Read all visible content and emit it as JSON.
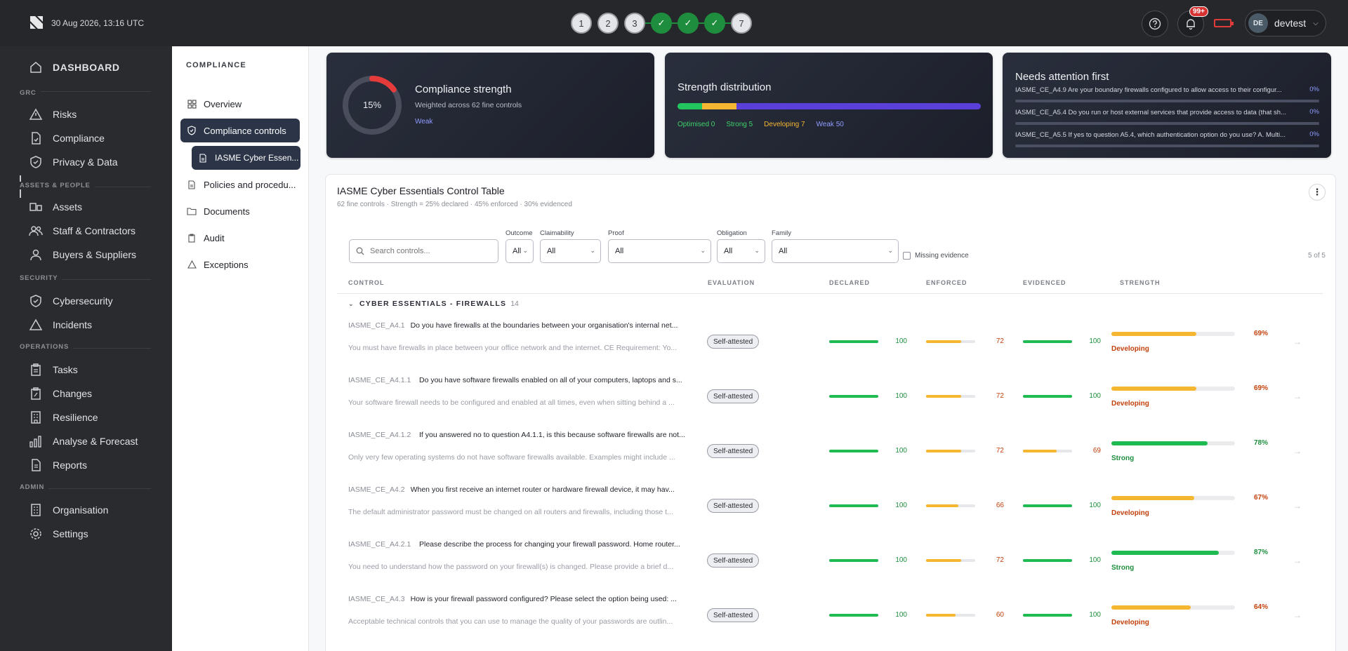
{
  "topbar": {
    "timestamp": "30 Aug 2026, 13:16 UTC",
    "steps": [
      {
        "label": "1",
        "done": false
      },
      {
        "label": "2",
        "done": false
      },
      {
        "label": "3",
        "done": false
      },
      {
        "label": "✓",
        "done": true
      },
      {
        "label": "✓",
        "done": true
      },
      {
        "label": "✓",
        "done": true
      },
      {
        "label": "7",
        "done": false
      }
    ],
    "notification_badge": "99+",
    "user_initials": "DE",
    "username": "devtest",
    "icons": {
      "help": "help-icon",
      "bell": "bell-icon",
      "battery": "battery-icon",
      "chevron": "chevron-down-icon"
    }
  },
  "sidebar": {
    "dashboard": "DASHBOARD",
    "sections": {
      "grc": "GRC",
      "assets": "ASSETS & PEOPLE",
      "security": "SECURITY",
      "operations": "OPERATIONS",
      "admin": "ADMIN"
    },
    "items": {
      "risks": "Risks",
      "compliance": "Compliance",
      "privacy": "Privacy & Data",
      "assets": "Assets",
      "staff": "Staff & Contractors",
      "buyers": "Buyers & Suppliers",
      "cybersecurity": "Cybersecurity",
      "incidents": "Incidents",
      "tasks": "Tasks",
      "changes": "Changes",
      "resilience": "Resilience",
      "analyse": "Analyse & Forecast",
      "reports": "Reports",
      "organisation": "Organisation",
      "settings": "Settings"
    }
  },
  "subnav": {
    "title": "COMPLIANCE",
    "overview": "Overview",
    "controls": "Compliance controls",
    "child": "IASME Cyber Essen...",
    "policies": "Policies and procedu...",
    "documents": "Documents",
    "audit": "Audit",
    "exceptions": "Exceptions"
  },
  "strength_card": {
    "percent": "15%",
    "percent_value": 15,
    "title": "Compliance strength",
    "subtitle": "Weighted across 62 fine controls",
    "tag": "Weak"
  },
  "distribution_card": {
    "title": "Strength distribution",
    "optimised": "Optimised 0",
    "strong": "Strong 5",
    "developing": "Developing 7",
    "weak": "Weak 50",
    "counts": {
      "optimised": 0,
      "strong": 5,
      "developing": 7,
      "weak": 50
    },
    "colors": {
      "optimised": "#22c55e",
      "strong": "#22c55e",
      "developing": "#f5b731",
      "weak": "#5b3fd9"
    }
  },
  "attention_card": {
    "title": "Needs attention first",
    "items": [
      {
        "id": "IASME_CE_A4.9",
        "text": "Are your boundary firewalls configured to allow access to their configur...",
        "pct": "0%"
      },
      {
        "id": "IASME_CE_A5.4",
        "text": "Do you run or host external services that provide access to data (that sh...",
        "pct": "0%"
      },
      {
        "id": "IASME_CE_A5.5",
        "text": "If yes to question A5.4, which authentication option do you use? A. Multi...",
        "pct": "0%"
      }
    ]
  },
  "table": {
    "title": "IASME Cyber Essentials Control Table",
    "subtitle": "62 fine controls · Strength = 25% declared · 45% enforced · 30% evidenced",
    "search_placeholder": "Search controls...",
    "filters": {
      "outcome": {
        "label": "Outcome",
        "value": "All"
      },
      "claimability": {
        "label": "Claimability",
        "value": "All"
      },
      "proof": {
        "label": "Proof",
        "value": "All"
      },
      "obligation": {
        "label": "Obligation",
        "value": "All"
      },
      "family": {
        "label": "Family",
        "value": "All"
      }
    },
    "missing_evidence": "Missing evidence",
    "count": "5 of 5",
    "headers": {
      "control": "CONTROL",
      "evaluation": "EVALUATION",
      "declared": "DECLARED",
      "enforced": "ENFORCED",
      "evidenced": "EVIDENCED",
      "strength": "STRENGTH"
    },
    "group": {
      "name": "CYBER ESSENTIALS - FIREWALLS",
      "count": "14"
    },
    "rows": [
      {
        "id": "IASME_CE_A4.1",
        "q": "Do you have firewalls at the boundaries between your organisation's internal net...",
        "desc": "You must have firewalls in place between your office network and the internet. CE Requirement: Yo...",
        "eval": "Self-attested",
        "declared": 100,
        "enforced": 72,
        "evidenced": 100,
        "strength": 69,
        "strength_pct": "69%",
        "level": "Developing"
      },
      {
        "id": "IASME_CE_A4.1.1",
        "q": "Do you have software firewalls enabled on all of your computers, laptops and s...",
        "desc": "Your software firewall needs to be configured and enabled at all times, even when sitting behind a ...",
        "eval": "Self-attested",
        "declared": 100,
        "enforced": 72,
        "evidenced": 100,
        "strength": 69,
        "strength_pct": "69%",
        "level": "Developing"
      },
      {
        "id": "IASME_CE_A4.1.2",
        "q": "If you answered no to question A4.1.1, is this because software firewalls are not...",
        "desc": "Only very few operating systems do not have software firewalls available. Examples might include ...",
        "eval": "Self-attested",
        "declared": 100,
        "enforced": 72,
        "evidenced": 69,
        "strength": 78,
        "strength_pct": "78%",
        "level": "Strong"
      },
      {
        "id": "IASME_CE_A4.2",
        "q": "When you first receive an internet router or hardware firewall device, it may hav...",
        "desc": "The default administrator password must be changed on all routers and firewalls, including those t...",
        "eval": "Self-attested",
        "declared": 100,
        "enforced": 66,
        "evidenced": 100,
        "strength": 67,
        "strength_pct": "67%",
        "level": "Developing"
      },
      {
        "id": "IASME_CE_A4.2.1",
        "q": "Please describe the process for changing your firewall password. Home router...",
        "desc": "You need to understand how the password on your firewall(s) is changed. Please provide a brief d...",
        "eval": "Self-attested",
        "declared": 100,
        "enforced": 72,
        "evidenced": 100,
        "strength": 87,
        "strength_pct": "87%",
        "level": "Strong"
      },
      {
        "id": "IASME_CE_A4.3",
        "q": "How is your firewall password configured? Please select the option being used: ...",
        "desc": "Acceptable technical controls that you can use to manage the quality of your passwords are outlin...",
        "eval": "Self-attested",
        "declared": 100,
        "enforced": 60,
        "evidenced": 100,
        "strength": 64,
        "strength_pct": "64%",
        "level": "Developing"
      }
    ]
  },
  "colors": {
    "green": "#1fba52",
    "amber": "#f5b731",
    "accent": "#8e9bff",
    "ok_text": "#1e8e3e",
    "warn_text": "#c2410c"
  }
}
